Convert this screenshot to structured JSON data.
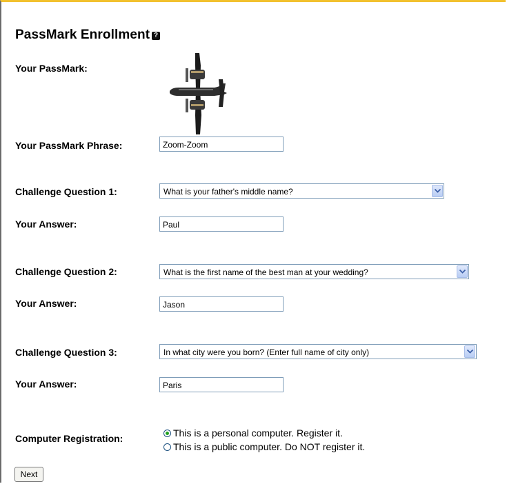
{
  "title": "PassMark Enrollment",
  "help_icon": "?",
  "passmark": {
    "label": "Your PassMark:",
    "image": "airplane-image"
  },
  "phrase": {
    "label": "Your PassMark Phrase:",
    "value": "Zoom-Zoom"
  },
  "questions": [
    {
      "label": "Challenge Question 1:",
      "selected": "What is your father's middle name?",
      "answer_label": "Your Answer:",
      "answer": "Paul"
    },
    {
      "label": "Challenge Question 2:",
      "selected": "What is the first name of the best man at your wedding?",
      "answer_label": "Your Answer:",
      "answer": "Jason"
    },
    {
      "label": "Challenge Question 3:",
      "selected": "In what city were you born? (Enter full name of city only)",
      "answer_label": "Your Answer:",
      "answer": "Paris"
    }
  ],
  "registration": {
    "label": "Computer Registration:",
    "options": [
      {
        "text": "This is a personal computer. Register it.",
        "selected": true
      },
      {
        "text": "This is a public computer. Do NOT register it.",
        "selected": false
      }
    ]
  },
  "next_label": "Next",
  "colors": {
    "top_border": "#f2c12e",
    "input_border": "#7f9db9",
    "radio_dot": "#21a121"
  }
}
